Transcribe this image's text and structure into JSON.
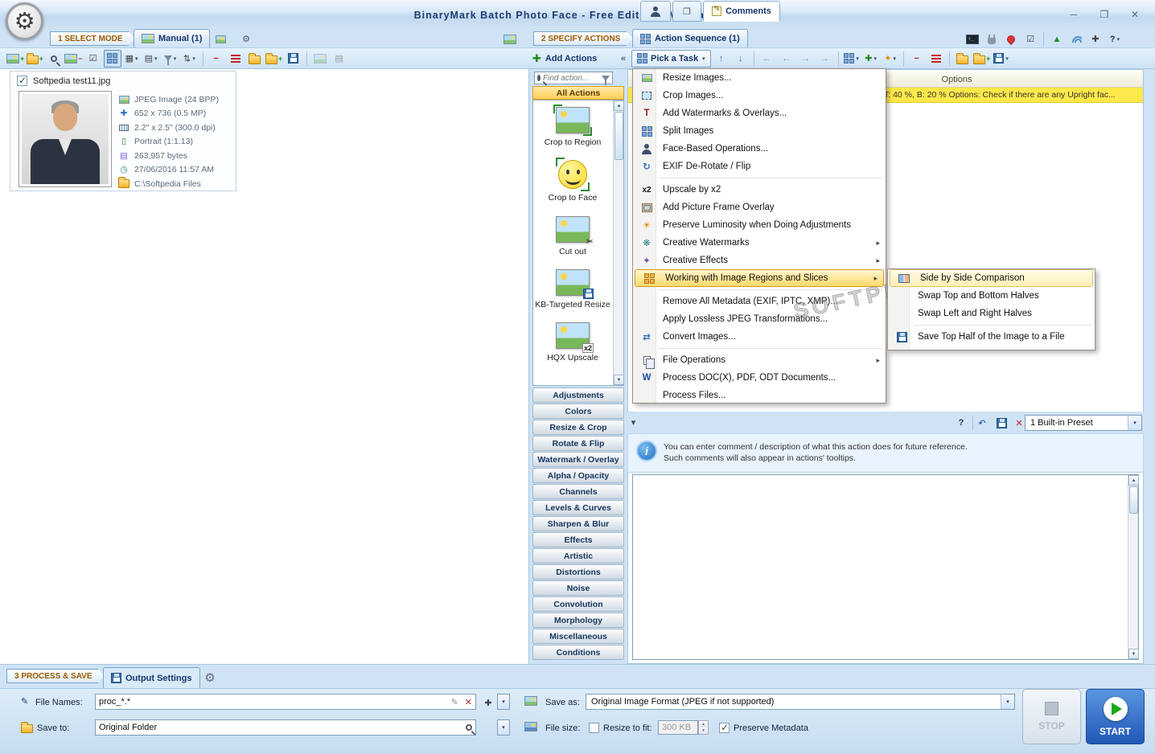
{
  "window": {
    "title": "BinaryMark Batch Photo Face - Free Edition - Manual Mode"
  },
  "icons": {
    "gear": "⚙",
    "minimize": "─",
    "maximize": "❐",
    "close": "✕",
    "dropdown": "▾",
    "submenu_arrow": "▸",
    "scroll_up": "▲",
    "scroll_down": "▼",
    "up": "↑",
    "down": "↓",
    "left": "←",
    "right": "→",
    "plus": "✚",
    "minus": "−",
    "pencil": "✎",
    "cross": "✕",
    "check": "✓",
    "sun": "☀",
    "scissors": "✂",
    "sparkle": "❋",
    "star": "✦",
    "undo": "↶",
    "convert": "⇄",
    "rotate": "↻",
    "question": "?",
    "clock": "◷",
    "portrait": "▯",
    "list": "▤",
    "grid": "▦",
    "checklist": "☑",
    "info": "i",
    "green_up": "▲",
    "x2": "x2",
    "t": "T",
    "w": "W",
    "collapse": "«"
  },
  "nav": {
    "select_mode": "1 SELECT MODE",
    "manual_tab": "Manual (1)",
    "specify_actions": "2 SPECIFY ACTIONS",
    "action_sequence_tab": "Action Sequence (1)",
    "process_save": "3 PROCESS & SAVE",
    "output_settings_tab": "Output Settings"
  },
  "file_panel": {
    "file_name": "Softpedia test11.jpg",
    "meta": [
      "JPEG Image (24 BPP)",
      "652 x 736 (0.5 MP)",
      "2.2\" x 2.5\" (300.0 dpi)",
      "Portrait (1:1.13)",
      "263,957 bytes",
      "27/06/2016 11:57 AM",
      "C:\\Softpedia Files"
    ]
  },
  "actions_panel": {
    "header": "Add Actions",
    "search_placeholder": "Find action...",
    "all_actions": "All Actions",
    "items": [
      "Crop to Region",
      "Crop to Face",
      "Cut out",
      "KB-Targeted Resize",
      "HQX Upscale"
    ],
    "categories": [
      "Adjustments",
      "Colors",
      "Resize & Crop",
      "Rotate & Flip",
      "Watermark / Overlay",
      "Alpha / Opacity",
      "Channels",
      "Levels & Curves",
      "Sharpen & Blur",
      "Effects",
      "Artistic",
      "Distortions",
      "Noise",
      "Convolution",
      "Morphology",
      "Miscellaneous",
      "Conditions"
    ]
  },
  "task_bar": {
    "pick_a_task": "Pick a Task"
  },
  "sequence": {
    "options_header": "Options",
    "row_text": "T: 40 %, B: 20 % Options: Check if there are any Upright fac..."
  },
  "menu": {
    "items": [
      "Resize Images...",
      "Crop Images...",
      "Add Watermarks & Overlays...",
      "Split Images",
      "Face-Based Operations...",
      "EXIF De-Rotate / Flip",
      "Upscale by x2",
      "Add Picture Frame Overlay",
      "Preserve Luminosity when Doing Adjustments",
      "Creative Watermarks",
      "Creative Effects",
      "Working with Image Regions and Slices",
      "Remove All Metadata (EXIF, IPTC, XMP)...",
      "Apply Lossless JPEG Transformations...",
      "Convert Images...",
      "File Operations",
      "Process DOC(X), PDF, ODT Documents...",
      "Process Files..."
    ],
    "submenu": [
      "Side by Side Comparison",
      "Swap Top and Bottom Halves",
      "Swap Left and Right Halves",
      "Save Top Half of the Image to a File"
    ]
  },
  "comments_panel": {
    "tab": "Comments",
    "preset": "1 Built-in Preset",
    "info_line1": "You can enter comment / description of what this action does for future reference.",
    "info_line2": "Such comments will also appear in actions' tooltips."
  },
  "output_panel": {
    "file_names_label": "File Names:",
    "file_names_value": "proc_*.*",
    "save_to_label": "Save to:",
    "save_to_value": "Original Folder",
    "save_as_label": "Save as:",
    "save_as_value": "Original Image Format (JPEG if not supported)",
    "file_size_label": "File size:",
    "resize_to_fit": "Resize to fit:",
    "size_value": "300 KB",
    "preserve_metadata": "Preserve Metadata",
    "stop": "STOP",
    "start": "START"
  },
  "watermark": "SOFTPEDIA"
}
